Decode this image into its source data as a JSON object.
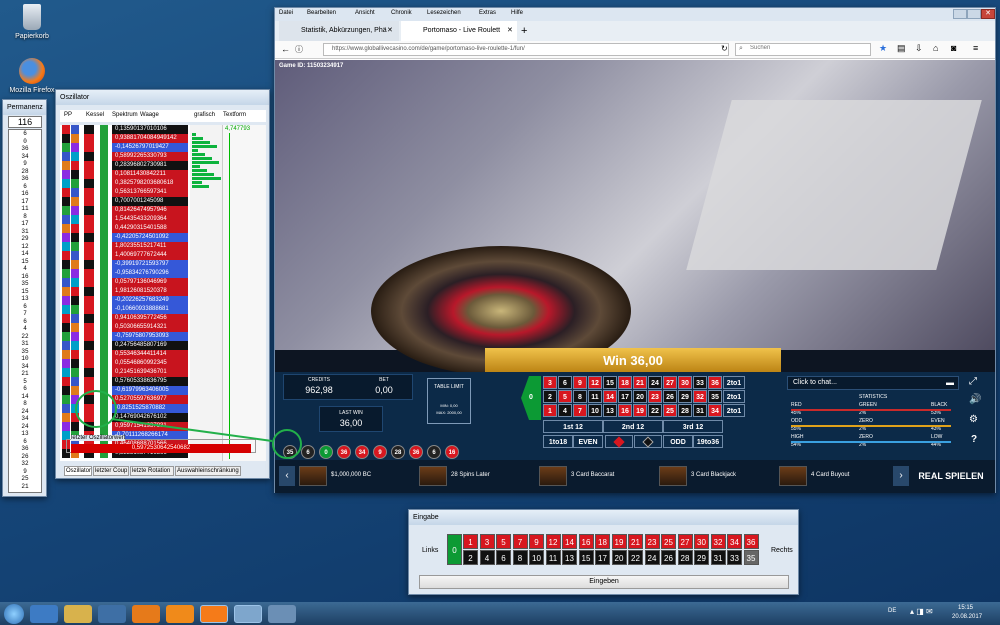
{
  "desktop": {
    "recycle_bin": "Papierkorb",
    "firefox": "Mozilla Firefox"
  },
  "permanenz": {
    "title": "Permanenz",
    "current": "116",
    "numbers": [
      "6",
      "0",
      "36",
      "34",
      "9",
      "28",
      "36",
      "6",
      "16",
      "17",
      "11",
      "8",
      "17",
      "31",
      "29",
      "12",
      "14",
      "15",
      "4",
      "16",
      "35",
      "15",
      "13",
      "6",
      "7",
      "6",
      "4",
      "22",
      "31",
      "35",
      "10",
      "34",
      "21",
      "5",
      "6",
      "14",
      "8",
      "24",
      "34",
      "24",
      "13",
      "6",
      "36",
      "26",
      "32",
      "9",
      "25",
      "21"
    ]
  },
  "oszillator": {
    "title": "Oszillator",
    "headers": {
      "pp": "PP",
      "kessel": "Kessel",
      "spektrum": "Spektrum",
      "waage": "Waage",
      "grafisch": "grafisch",
      "textform": "Textform"
    },
    "top_value": "4,747793",
    "waage_values": [
      "0,13590137010106",
      "0,93881704084949142",
      "-0,14526797019427",
      "0,58992265330793",
      "0,28396802730981",
      "0,10811430842211",
      "0,3825798203680618",
      "0,56313766597341",
      "0,7007001245098",
      "0,81426474957946",
      "1,54435433209364",
      "0,44290315401588",
      "-0,42205724501092",
      "1,80235515217411",
      "1,40069777672444",
      "-0,39919721593797",
      "-0,95834276790296",
      "0,05797136046969",
      "1,98126081520378",
      "-0,20226257683249",
      "-0,10660933888681",
      "0,94106395772456",
      "0,50306655914321",
      "-0,75975807953093",
      "0,24756485807169",
      "0,55346344411414",
      "0,05546860992345",
      "0,21451639436701",
      "0,57605338636795",
      "-0,61979963406005",
      "0,52705597636977",
      "-0,8251525870882",
      "0,14769042676102",
      "0,95971541937831",
      "-0,70111268266174",
      "0,46408688701566",
      "0,32531087716366"
    ],
    "last_label": "letzter Oszillatorwert",
    "last_value": "0,5972530642540682",
    "tabs": [
      "Oszillator",
      "letzter Coup",
      "letzte Rotation",
      "Auswahleinschränkung"
    ]
  },
  "browser": {
    "menu": [
      "Datei",
      "Bearbeiten",
      "Ansicht",
      "Chronik",
      "Lesezeichen",
      "Extras",
      "Hilfe"
    ],
    "tabs": [
      "Statistik, Abkürzungen, Phä",
      "Portomaso - Live Roulett"
    ],
    "url": "https://www.globallivecasino.com/de/game/portomaso-live-roulette-1/fun/",
    "search_placeholder": "Suchen"
  },
  "game": {
    "game_id": "Game ID: 11503234917",
    "win_text": "Win 36,00",
    "credits_label": "CREDITS",
    "credits": "962,98",
    "bet_label": "BET",
    "bet": "0,00",
    "last_win_label": "LAST WIN",
    "last_win": "36,00",
    "limit_label": "TABLE LIMIT",
    "limit_min": "MIN: 0,00",
    "limit_max": "MAX: 2000,00",
    "zero": "0",
    "row_top": [
      "3",
      "6",
      "9",
      "12",
      "15",
      "18",
      "21",
      "24",
      "27",
      "30",
      "33",
      "36"
    ],
    "row_mid": [
      "2",
      "5",
      "8",
      "11",
      "14",
      "17",
      "20",
      "23",
      "26",
      "29",
      "32",
      "35"
    ],
    "row_bot": [
      "1",
      "4",
      "7",
      "10",
      "13",
      "16",
      "19",
      "22",
      "25",
      "28",
      "31",
      "34"
    ],
    "col_label": "2to1",
    "dozens": [
      "1st 12",
      "2nd 12",
      "3rd 12"
    ],
    "outside": [
      "1to18",
      "EVEN",
      "ODD",
      "19to36"
    ],
    "recent": [
      "35",
      "6",
      "0",
      "36",
      "34",
      "9",
      "28",
      "36",
      "6",
      "16"
    ],
    "chat": "Click to chat...",
    "stats": {
      "title": "STATISTICS",
      "rows": [
        [
          "RED",
          "GREEN",
          "BLACK"
        ],
        [
          "45%",
          "2%",
          "53%"
        ],
        [
          "ODD",
          "ZERO",
          "EVEN"
        ],
        [
          "55%",
          "2%",
          "43%"
        ],
        [
          "HIGH",
          "ZERO",
          "LOW"
        ],
        [
          "54%",
          "2%",
          "44%"
        ]
      ]
    },
    "games": [
      "$1,000,000 BC",
      "28 Spins Later",
      "3 Card Baccarat",
      "3 Card Blackjack",
      "4 Card Buyout"
    ],
    "play": "REAL SPIELEN"
  },
  "eingabe": {
    "title": "Eingabe",
    "links": "Links",
    "rechts": "Rechts",
    "button": "Eingeben",
    "zero": "0",
    "top": [
      "1",
      "3",
      "5",
      "7",
      "9",
      "12",
      "14",
      "16",
      "18",
      "19",
      "21",
      "23",
      "25",
      "27",
      "30",
      "32",
      "34",
      "36"
    ],
    "bot": [
      "2",
      "4",
      "6",
      "8",
      "10",
      "11",
      "13",
      "15",
      "17",
      "20",
      "22",
      "24",
      "26",
      "28",
      "29",
      "31",
      "33",
      "35"
    ]
  },
  "taskbar": {
    "lang": "DE",
    "time": "15:15",
    "date": "20.08.2017"
  },
  "colors": {
    "red": "#d7171f",
    "black": "#111111",
    "green": "#0c9a34",
    "gold": "#c8951a"
  }
}
